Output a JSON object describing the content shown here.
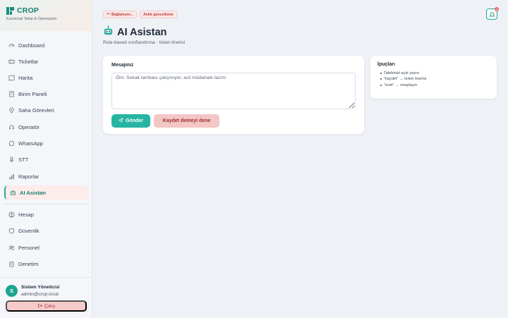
{
  "brand": {
    "name": "CROP",
    "subtitle": "Kurumsal Talep & Operasyon"
  },
  "nav": {
    "items": [
      {
        "label": "Dashboard",
        "icon": "gauge-icon"
      },
      {
        "label": "Ticketlar",
        "icon": "ticket-icon"
      },
      {
        "label": "Harita",
        "icon": "map-icon"
      },
      {
        "label": "Birim Paneli",
        "icon": "building-icon"
      },
      {
        "label": "Saha Görevleri",
        "icon": "location-pin-icon"
      },
      {
        "label": "Operatör",
        "icon": "headset-icon"
      },
      {
        "label": "WhatsApp",
        "icon": "whatsapp-icon"
      },
      {
        "label": "STT",
        "icon": "microphone-icon"
      },
      {
        "label": "Raporlar",
        "icon": "bar-chart-icon"
      },
      {
        "label": "AI Asistan",
        "icon": "robot-icon",
        "active": true
      }
    ],
    "secondary": [
      {
        "label": "Hesap",
        "icon": "user-circle-icon"
      },
      {
        "label": "Güvenlik",
        "icon": "shield-icon"
      },
      {
        "label": "Personel",
        "icon": "users-icon"
      },
      {
        "label": "Denetim",
        "icon": "clipboard-icon"
      }
    ]
  },
  "user": {
    "initial": "S",
    "name": "Sistem Yöneticisi",
    "email": "admin@crop.local",
    "logout_label": "Çıkış"
  },
  "status": {
    "connecting": "Bağlanıyor...",
    "live": "Anlık güncelleme"
  },
  "page": {
    "title": "AI Asistan",
    "subtitle": "Rule-based sınıflandırma · ticket önerisi"
  },
  "form": {
    "label": "Mesajınız",
    "placeholder": "Örn: Sokak lambası çalışmıyor, acil müdahale lazım",
    "send_label": "Gönder",
    "try_label": "Kaydet demeyi dene"
  },
  "tips": {
    "title": "İpuçları",
    "items": [
      "Talebinizi açık yazın",
      "\"kaydet\" → ticket önerisi",
      "\"evet\" → onaylayın"
    ]
  },
  "notifications": {
    "count": "0"
  },
  "colors": {
    "accent": "#1fae9a",
    "brand": "#17806f",
    "danger": "#c23b3b"
  }
}
